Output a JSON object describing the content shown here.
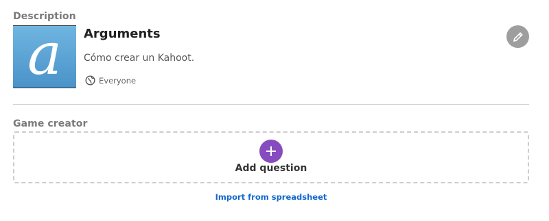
{
  "description": {
    "section_title": "Description",
    "cover_letter": "a",
    "title": "Arguments",
    "text": "Cómo crear un Kahoot.",
    "visibility": "Everyone",
    "edit_icon": "pencil-icon"
  },
  "game_creator": {
    "section_title": "Game creator",
    "add_question_label": "Add question",
    "add_icon": "plus-icon",
    "import_label": "Import from spreadsheet"
  },
  "colors": {
    "accent_purple": "#864cbf",
    "link_blue": "#1368ce",
    "edit_gray": "#9e9e9e",
    "cover_blue": "#5aa3d6"
  }
}
